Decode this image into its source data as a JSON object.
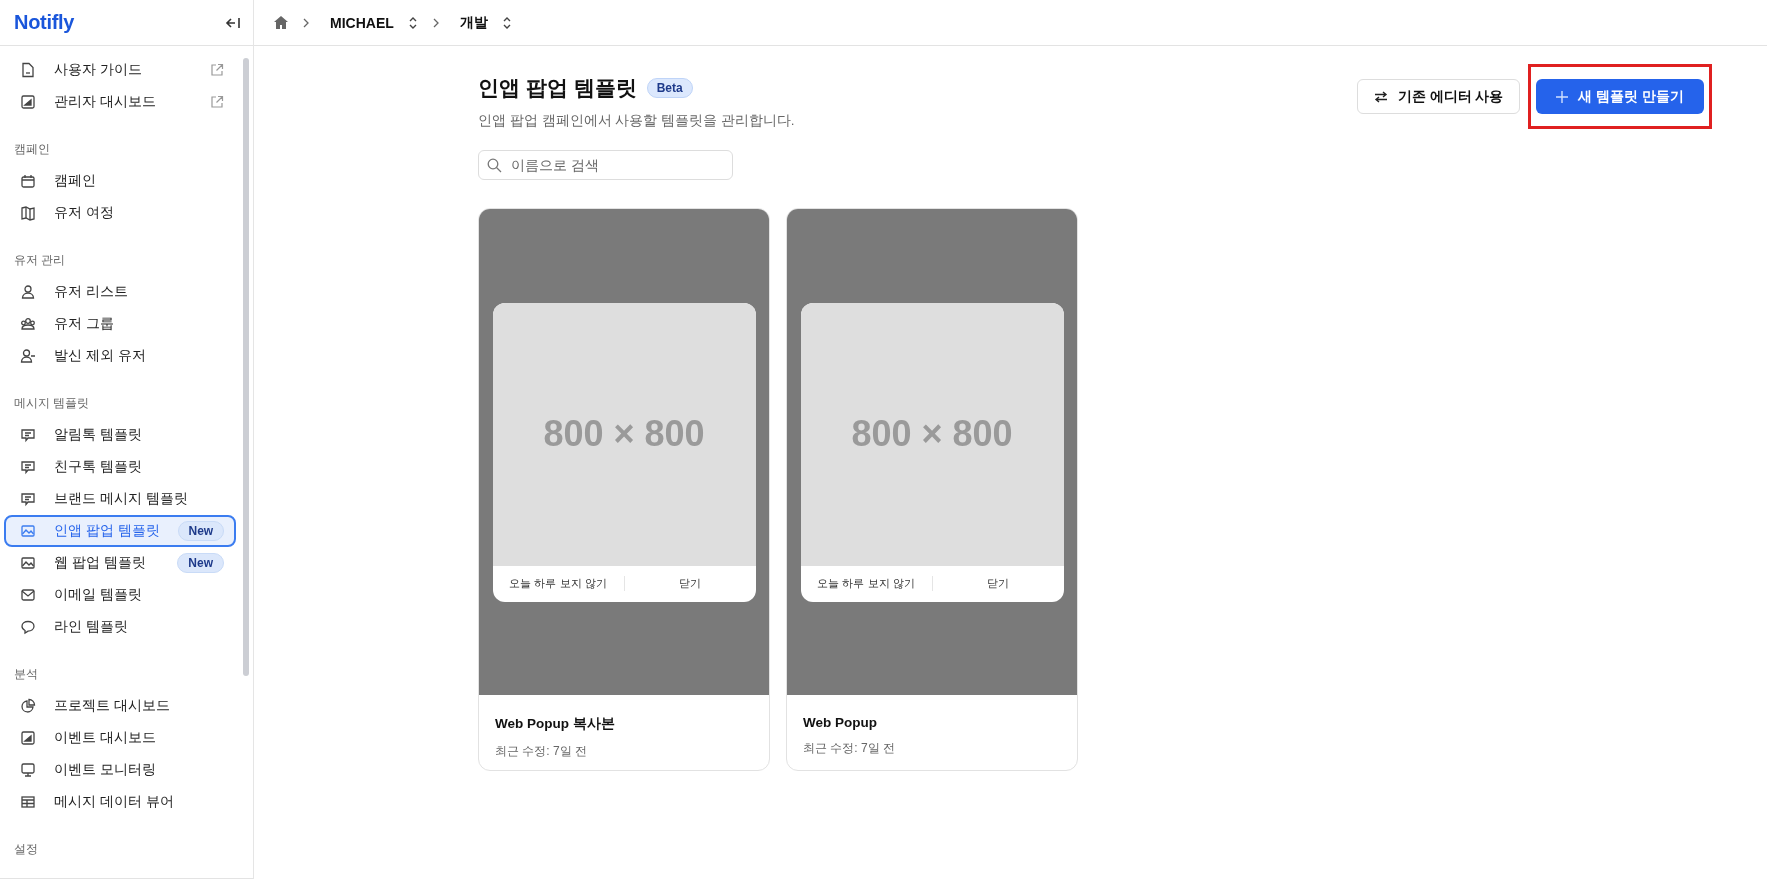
{
  "sidebar": {
    "logo": "Notifly",
    "sections": [
      {
        "items": [
          {
            "label": "사용자 가이드",
            "selected": false,
            "external": true
          },
          {
            "label": "관리자 대시보드",
            "selected": false,
            "external": true
          }
        ]
      },
      {
        "heading": "캠페인",
        "items": [
          {
            "label": "캠페인",
            "selected": false
          },
          {
            "label": "유저 여정",
            "selected": false
          }
        ]
      },
      {
        "heading": "유저 관리",
        "items": [
          {
            "label": "유저 리스트",
            "selected": false
          },
          {
            "label": "유저 그룹",
            "selected": false
          },
          {
            "label": "발신 제외 유저",
            "selected": false
          }
        ]
      },
      {
        "heading": "메시지 템플릿",
        "items": [
          {
            "label": "알림톡 템플릿",
            "selected": false
          },
          {
            "label": "친구톡 템플릿",
            "selected": false
          },
          {
            "label": "브랜드 메시지 템플릿",
            "selected": false
          },
          {
            "label": "인앱 팝업 템플릿",
            "selected": true,
            "badge": "New"
          },
          {
            "label": "웹 팝업 템플릿",
            "selected": false,
            "badge": "New"
          },
          {
            "label": "이메일 템플릿",
            "selected": false
          },
          {
            "label": "라인 템플릿",
            "selected": false
          }
        ]
      },
      {
        "heading": "분석",
        "items": [
          {
            "label": "프로젝트 대시보드",
            "selected": false
          },
          {
            "label": "이벤트 대시보드",
            "selected": false
          },
          {
            "label": "이벤트 모니터링",
            "selected": false
          },
          {
            "label": "메시지 데이터 뷰어",
            "selected": false
          }
        ]
      },
      {
        "heading": "설정"
      }
    ]
  },
  "breadcrumb": [
    "MICHAEL",
    "개발"
  ],
  "page": {
    "title": "인앱 팝업 템플릿",
    "badge": "Beta",
    "subtitle": "인앱 팝업 캠페인에서 사용할 템플릿을 관리합니다.",
    "search": {
      "placeholder": "이름으로 검색"
    },
    "buttons": [
      {
        "label": "기존 에디터 사용",
        "kind": "secondary",
        "highlighted": false
      },
      {
        "label": "새 템플릿 만들기",
        "kind": "primary",
        "highlighted": true
      }
    ]
  },
  "templates": [
    {
      "name": "Web Popup 복사본",
      "modified": "최근 수정: 7일 전",
      "image_size": "800 × 800",
      "actions": [
        "오늘 하루 보지 않기",
        "닫기"
      ]
    },
    {
      "name": "Web Popup",
      "modified": "최근 수정: 7일 전",
      "image_size": "800 × 800",
      "actions": [
        "오늘 하루 보지 않기",
        "닫기"
      ]
    }
  ]
}
